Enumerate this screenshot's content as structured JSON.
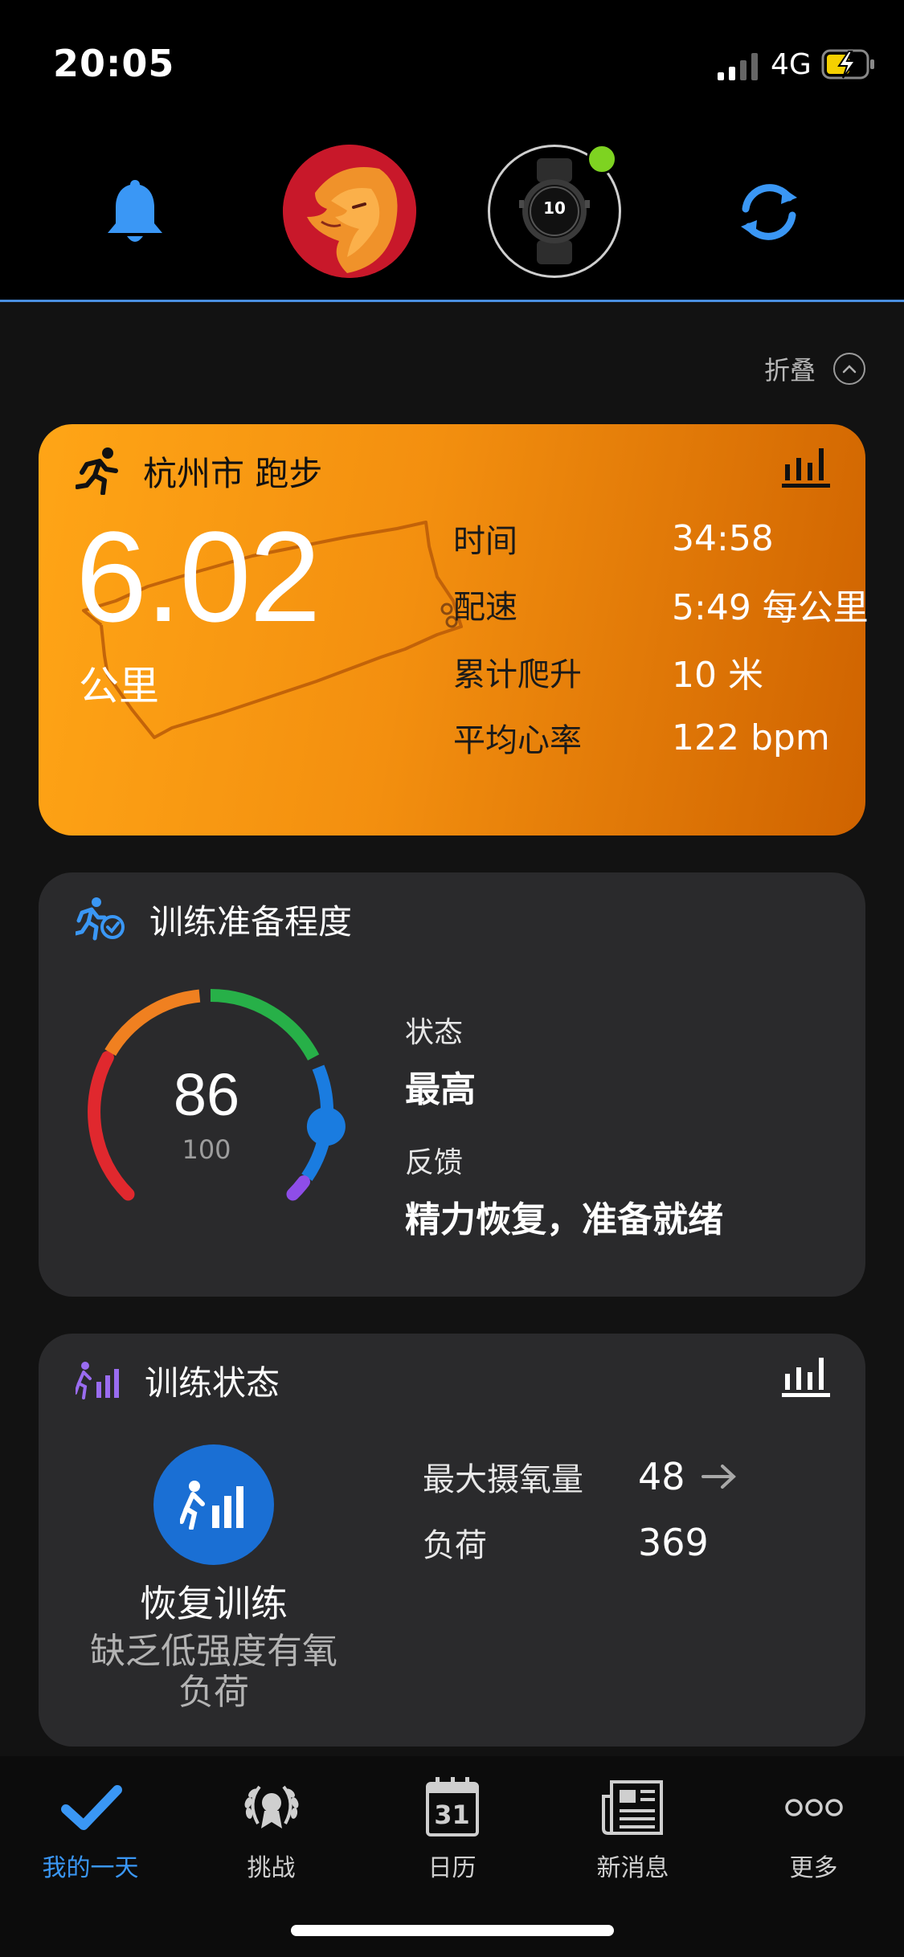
{
  "status_bar": {
    "time": "20:05",
    "network": "4G"
  },
  "colors": {
    "accent_blue": "#3a97f5",
    "run_card_gradient_start": "#ffa516",
    "run_card_gradient_end": "#cf6300",
    "card_bg": "#2a2a2c",
    "page_bg": "#121212"
  },
  "top_bar": {
    "icons": [
      "bell-icon",
      "avatar",
      "watch",
      "sync-icon"
    ],
    "watch_face_text": "10"
  },
  "collapse": {
    "label": "折叠"
  },
  "run_card": {
    "title": "杭州市 跑步",
    "distance": "6.02",
    "unit": "公里",
    "stats": [
      {
        "label": "时间",
        "value": "34:58"
      },
      {
        "label": "配速",
        "value": "5:49 每公里"
      },
      {
        "label": "累计爬升",
        "value": "10 米"
      },
      {
        "label": "平均心率",
        "value": "122 bpm"
      }
    ]
  },
  "readiness_card": {
    "title": "训练准备程度",
    "score": "86",
    "max": "100",
    "score_fraction": 0.86,
    "status_label": "状态",
    "status_value": "最高",
    "feedback_label": "反馈",
    "feedback_value": "精力恢复，准备就绪"
  },
  "training_status_card": {
    "title": "训练状态",
    "status": "恢复训练",
    "description": "缺乏低强度有氧负荷",
    "metrics": [
      {
        "label": "最大摄氧量",
        "value": "48"
      },
      {
        "label": "负荷",
        "value": "369"
      }
    ]
  },
  "bottom_nav": {
    "items": [
      {
        "label": "我的一天",
        "icon": "check-icon"
      },
      {
        "label": "挑战",
        "icon": "laurel-icon"
      },
      {
        "label": "日历",
        "icon": "calendar-icon",
        "day": "31"
      },
      {
        "label": "新消息",
        "icon": "newspaper-icon"
      },
      {
        "label": "更多",
        "icon": "more-dots-icon"
      }
    ]
  }
}
